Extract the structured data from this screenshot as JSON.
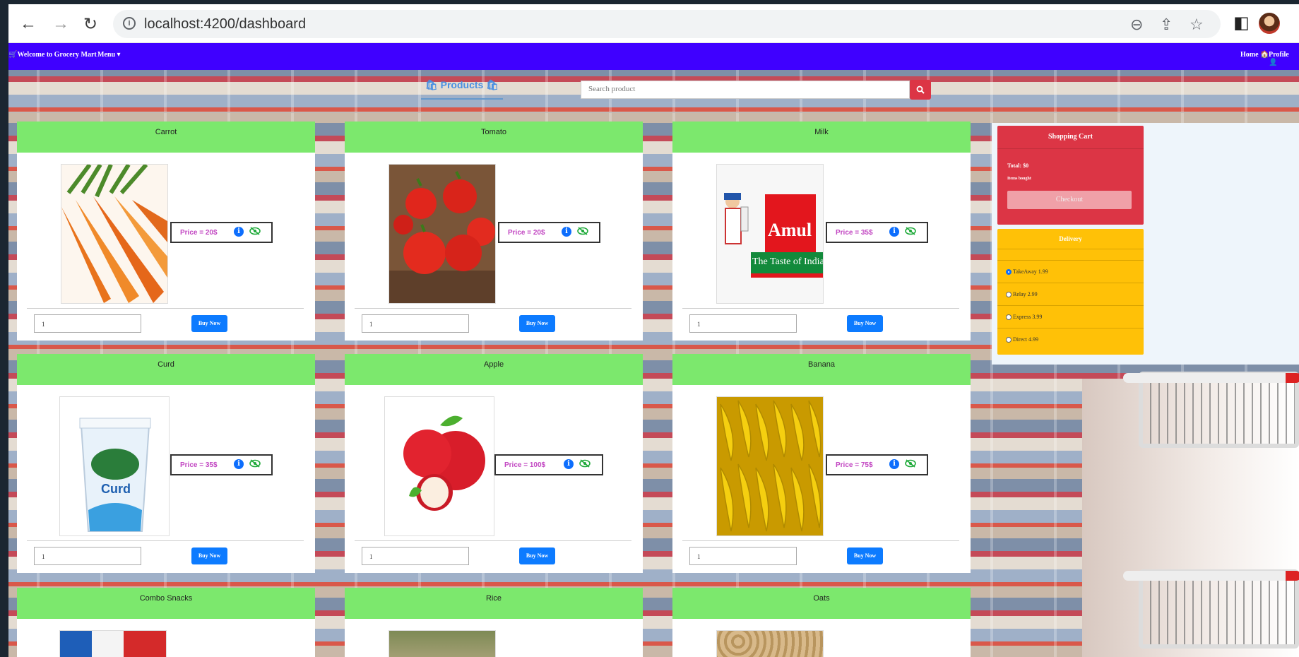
{
  "browser": {
    "url": "localhost:4200/dashboard"
  },
  "navbar": {
    "brand": "🛒Welcome to Grocery Mart",
    "menu_label": "Menu ▾",
    "home_label": "Home 🏠",
    "profile_label": "Profile 👤"
  },
  "toolbar": {
    "products_tab": "🛍 Products 🛍",
    "search_placeholder": "Search product"
  },
  "products": [
    {
      "name": "Carrot",
      "price": "Price = 20$",
      "qty": "1",
      "buy": "Buy Now"
    },
    {
      "name": "Tomato",
      "price": "Price = 20$",
      "qty": "1",
      "buy": "Buy Now"
    },
    {
      "name": "Milk",
      "price": "Price = 35$",
      "qty": "1",
      "buy": "Buy Now"
    },
    {
      "name": "Curd",
      "price": "Price = 35$",
      "qty": "1",
      "buy": "Buy Now"
    },
    {
      "name": "Apple",
      "price": "Price = 100$",
      "qty": "1",
      "buy": "Buy Now"
    },
    {
      "name": "Banana",
      "price": "Price = 75$",
      "qty": "1",
      "buy": "Buy Now"
    },
    {
      "name": "Combo Snacks",
      "price": "",
      "qty": "",
      "buy": ""
    },
    {
      "name": "Rice",
      "price": "",
      "qty": "",
      "buy": ""
    },
    {
      "name": "Oats",
      "price": "",
      "qty": "",
      "buy": ""
    }
  ],
  "cart": {
    "title": "Shopping Cart",
    "total": "Total: $0",
    "items": "Items bought",
    "checkout": "Checkout"
  },
  "delivery": {
    "title": "Delivery",
    "options": [
      "TakeAway 1.99",
      "Relay 2.99",
      "Express 3.99",
      "Direct 4.99"
    ],
    "selected": "TakeAway 1.99"
  },
  "image_text": {
    "milk_brand": "Amul",
    "milk_tagline": "The Taste of India",
    "curd_label": "Curd"
  },
  "colors": {
    "navbar": "#3f00ff",
    "card_header": "#7ce86d",
    "buy_button": "#0d7bff",
    "cart_panel": "#dc3545",
    "delivery_panel": "#ffc107",
    "price_text": "#c247c2"
  }
}
